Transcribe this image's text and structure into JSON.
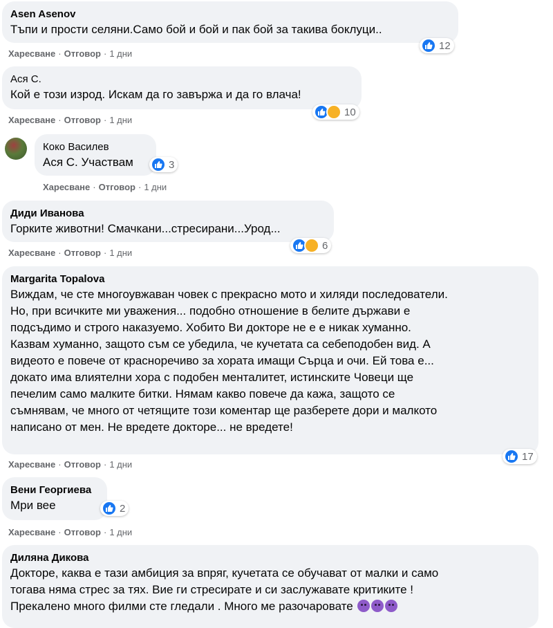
{
  "comments": [
    {
      "author": "Asen Asenov",
      "text": "Тъпи и прости селяни.Само бой и бой и пак бой за такива боклуци..",
      "like_label": "Харесване",
      "reply_label": "Отговор",
      "time": "1 дни",
      "reaction_count": "12"
    },
    {
      "author": "Ася С.",
      "text": "Кой е този изрод. Искам да го завържа и да го влача!",
      "like_label": "Харесване",
      "reply_label": "Отговор",
      "time": "1 дни",
      "reaction_count": "10"
    },
    {
      "author": "Коко Василев",
      "text": "Ася С. Участвам",
      "like_label": "Харесване",
      "reply_label": "Отговор",
      "time": "1 дни",
      "reaction_count": "3"
    },
    {
      "author": "Диди Иванова",
      "text": "Горките животни! Смачкани...стресирани...Урод...",
      "like_label": "Харесване",
      "reply_label": "Отговор",
      "time": "1 дни",
      "reaction_count": "6"
    },
    {
      "author": "Margarita Topalova",
      "text": "Виждам, че сте многоувжаван човек с прекрасно мото и хиляди последователи.\nНо, при всичките ми уважения... подобно отношение в белите държави е\nподсъдимо и строго наказуемо. Хобито Ви докторе не е е никак хуманно.\nКазвам хуманно, защото съм се убедила, че кучетата са себеподобен вид. А\nвидеото е повече от красноречиво за хората имащи Сърца и очи. Ей това е...\nдокато има влиятелни хора с подобен менталитет, истинските Човеци ще\nпечелим само малките битки. Нямам какво повече да кажа, защото се\nсъмнявам, че много от четящите този коментар ще разберете дори и малкото\nнаписано от мен. Не вредете докторе... не вредете!",
      "like_label": "Харесване",
      "reply_label": "Отговор",
      "time": "1 дни",
      "reaction_count": "17"
    },
    {
      "author": "Вени Георгиева",
      "text": "Мри вее",
      "like_label": "Харесване",
      "reply_label": "Отговор",
      "time": "1 дни",
      "reaction_count": "2"
    },
    {
      "author": "Диляна Дикова",
      "text": "Докторе, каква е тази амбиция за впряг, кучетата се обучават от малки и само\nтогава няма стрес за тях. Вие ги стресирате и си заслужавате критиките !\nПрекалено много филми сте гледали . Много ме разочаровате"
    }
  ],
  "separator": "·",
  "colors": {
    "bubble": "#f0f2f5",
    "like": "#1877f2",
    "meta": "#65676b"
  }
}
